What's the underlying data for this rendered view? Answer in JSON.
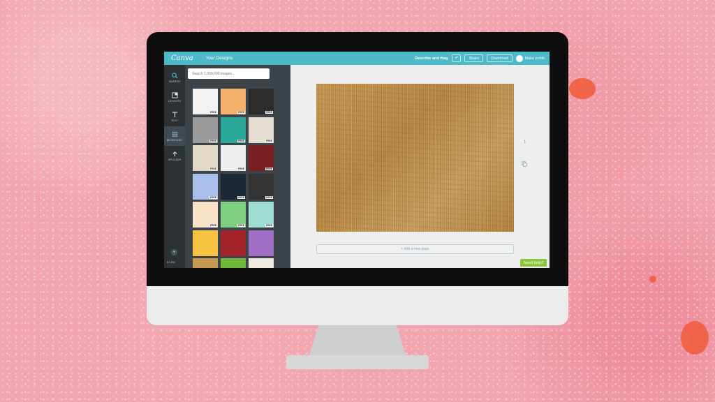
{
  "app": {
    "logo": "Canva",
    "nav_title": "Your Designs",
    "design_title": "Describe and #tag",
    "undo_symbol": "↶",
    "share_label": "Share",
    "download_label": "Download",
    "public_label": "Make public"
  },
  "sidebar": {
    "items": [
      {
        "label": "SEARCH",
        "icon": "search-icon"
      },
      {
        "label": "LAYOUTS",
        "icon": "layouts-icon"
      },
      {
        "label": "TEXT",
        "icon": "text-icon"
      },
      {
        "label": "BKGROUND",
        "icon": "background-icon"
      },
      {
        "label": "UPLOADS",
        "icon": "upload-icon"
      }
    ],
    "add_symbol": "+",
    "zoom": "67.4%"
  },
  "search": {
    "placeholder": "Search 1,000,000 images..."
  },
  "backgrounds": {
    "free_label": "FREE",
    "tiles": [
      {
        "color": "#f2f2f2",
        "free": true
      },
      {
        "color": "#f5b06b",
        "free": true
      },
      {
        "color": "#2c2c2c",
        "free": true
      },
      {
        "color": "#9c9c9c",
        "free": true
      },
      {
        "color": "#2aa89c",
        "free": true
      },
      {
        "color": "#e4ddd0",
        "free": true
      },
      {
        "color": "#e2d8c6",
        "free": true
      },
      {
        "color": "#eeeeee",
        "free": true
      },
      {
        "color": "#7a1f1f",
        "free": true
      },
      {
        "color": "#a9c0ea",
        "free": true
      },
      {
        "color": "#1c2a38",
        "free": true
      },
      {
        "color": "#333333",
        "free": true
      },
      {
        "color": "#f9e3c8",
        "free": true
      },
      {
        "color": "#80d184",
        "free": true
      },
      {
        "color": "#9fded2",
        "free": true
      },
      {
        "color": "#f6c343",
        "free": false
      },
      {
        "color": "#a3232b",
        "free": false
      },
      {
        "color": "#9e6fc5",
        "free": false
      },
      {
        "color": "#c49a52",
        "free": false
      },
      {
        "color": "#6fb83b",
        "free": false
      },
      {
        "color": "#f0e9df",
        "free": false
      }
    ]
  },
  "canvas": {
    "page_number": "1",
    "add_page_label": "+ Add a new page",
    "help_label": "Need help?"
  }
}
